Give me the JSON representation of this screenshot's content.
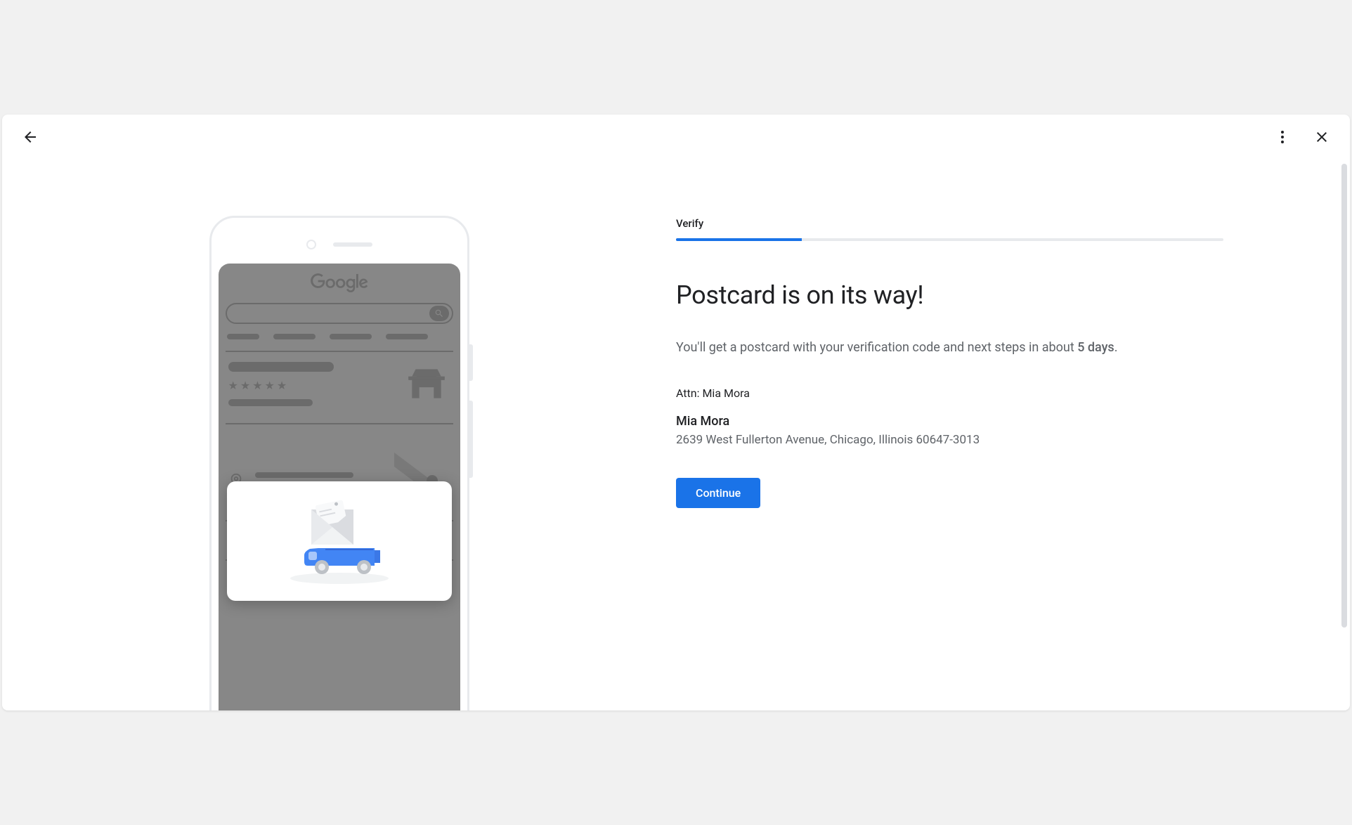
{
  "header": {
    "back_icon": "arrow-back",
    "more_icon": "more-vert",
    "close_icon": "close"
  },
  "step": {
    "label": "Verify",
    "progress_percent": 23
  },
  "content": {
    "title": "Postcard is on its way!",
    "description_prefix": "You'll get a postcard with your verification code and next steps in about ",
    "description_days": "5 days",
    "description_suffix": ".",
    "attn_prefix": "Attn: ",
    "attn_name": "Mia Mora",
    "business_name": "Mia Mora",
    "address": "2639 West Fullerton Avenue, Chicago, Illinois 60647-3013",
    "continue_label": "Continue"
  },
  "illustration": {
    "logo_text": "Google"
  }
}
